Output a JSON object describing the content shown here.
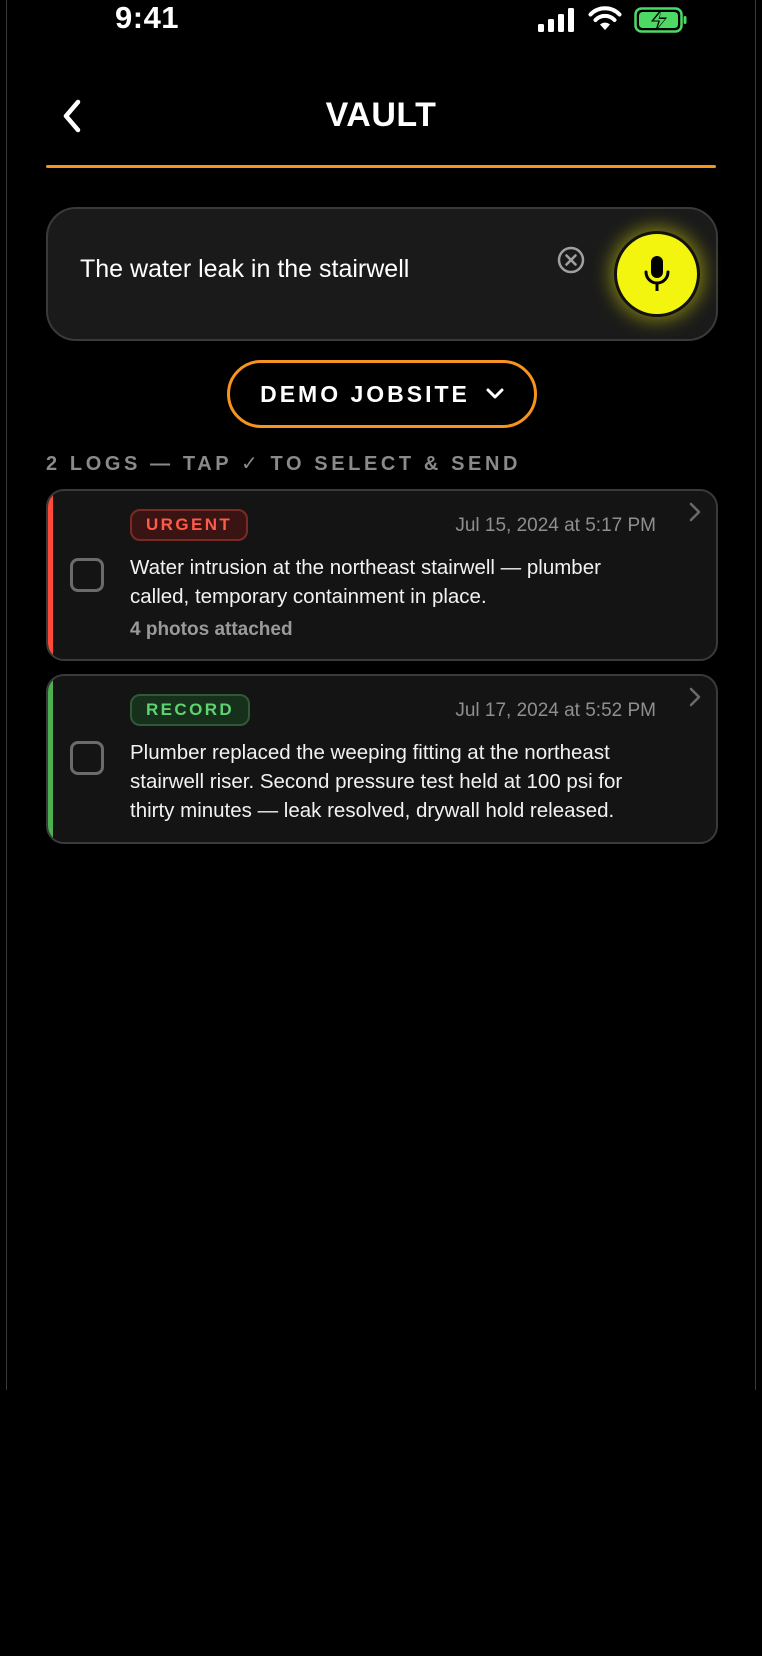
{
  "status_bar": {
    "time": "9:41"
  },
  "header": {
    "title": "VAULT"
  },
  "colors": {
    "accent": "#f7931e",
    "mic": "#f4f50e",
    "urgent": "#ff4a3a",
    "record": "#4caf50"
  },
  "search": {
    "value": "The water leak in the stairwell"
  },
  "jobsite": {
    "label": "DEMO JOBSITE"
  },
  "hint": "2 LOGS — TAP ✓ TO SELECT & SEND",
  "logs": [
    {
      "tag": "URGENT",
      "date": "Jul 15, 2024 at 5:17 PM",
      "text": "Water intrusion at the northeast stairwell — plumber called, temporary containment in place.",
      "meta": "4 photos attached"
    },
    {
      "tag": "RECORD",
      "date": "Jul 17, 2024 at 5:52 PM",
      "text": "Plumber replaced the weeping fitting at the northeast stairwell riser. Second pressure test held at 100 psi for thirty minutes — leak resolved, drywall hold released."
    }
  ]
}
